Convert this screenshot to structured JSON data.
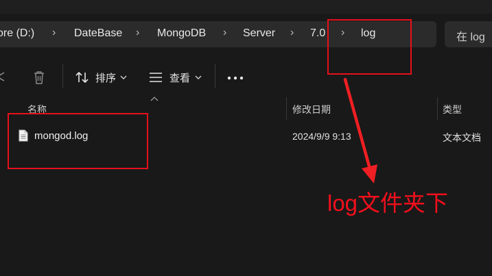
{
  "breadcrumb": {
    "items": [
      "ore (D:)",
      "DateBase",
      "MongoDB",
      "Server",
      "7.0",
      "log"
    ]
  },
  "search": {
    "placeholder": "在 log"
  },
  "toolbar": {
    "sort_label": "排序",
    "view_label": "查看"
  },
  "columns": {
    "name": "名称",
    "modified": "修改日期",
    "type": "类型"
  },
  "files": [
    {
      "name": "mongod.log",
      "modified": "2024/9/9 9:13",
      "type": "文本文档"
    }
  ],
  "annotation": {
    "text": "log文件夹下",
    "color": "#f20f1c"
  },
  "theme": {
    "background": "#191919",
    "bar": "#2b2b2b",
    "text": "#e6e6e6"
  }
}
